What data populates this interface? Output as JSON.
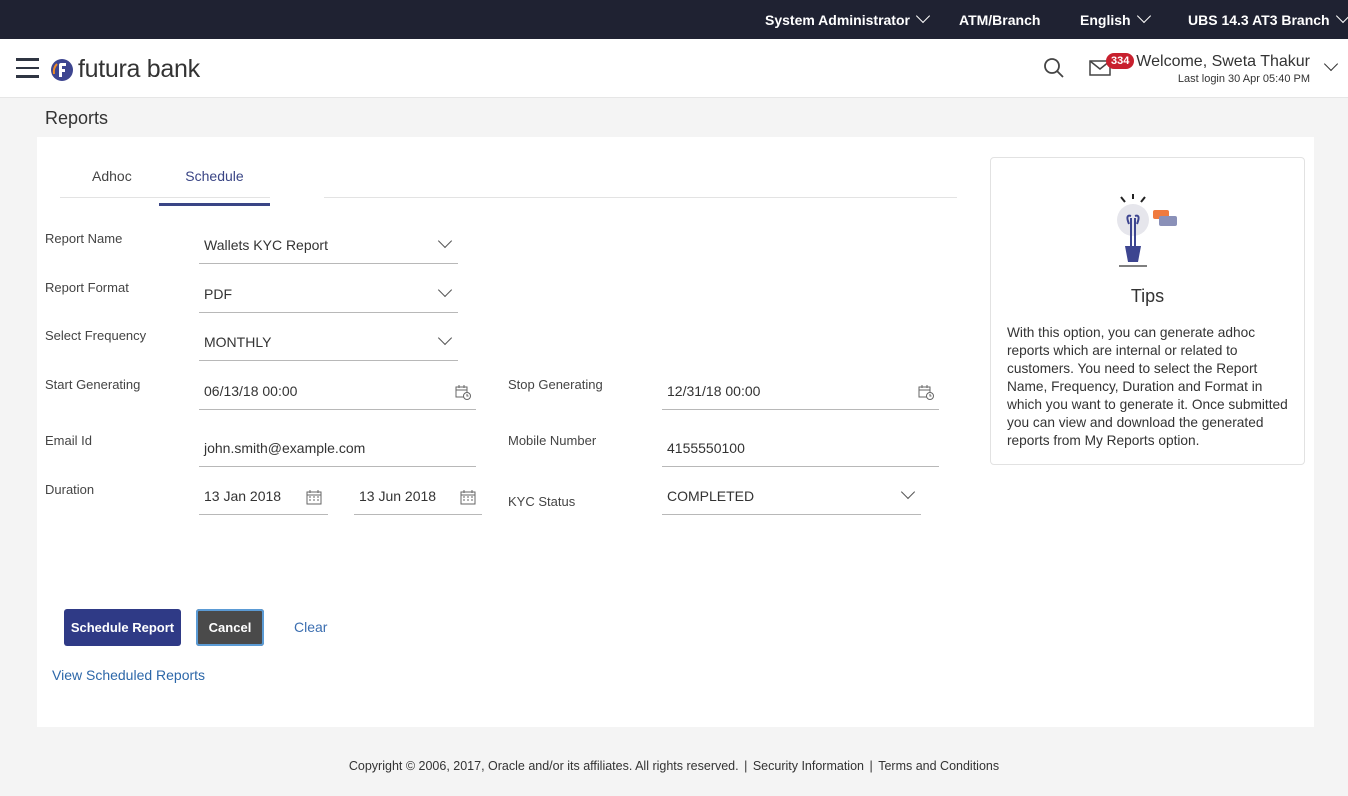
{
  "topbar": {
    "role": "System Administrator",
    "entity": "ATM/Branch",
    "language": "English",
    "branch": "UBS 14.3 AT3 Branch"
  },
  "header": {
    "logo_text": "futura bank",
    "notification_count": "334",
    "welcome": "Welcome, Sweta Thakur",
    "last_login": "Last login 30 Apr 05:40 PM"
  },
  "page": {
    "title": "Reports",
    "tabs": [
      {
        "label": "Adhoc"
      },
      {
        "label": "Schedule"
      }
    ]
  },
  "form": {
    "report_name": {
      "label": "Report Name",
      "value": "Wallets KYC Report"
    },
    "report_format": {
      "label": "Report Format",
      "value": "PDF"
    },
    "frequency": {
      "label": "Select Frequency",
      "value": "MONTHLY"
    },
    "start": {
      "label": "Start Generating",
      "value": "06/13/18 00:00"
    },
    "stop": {
      "label": "Stop Generating",
      "value": "12/31/18 00:00"
    },
    "email": {
      "label": "Email Id",
      "value": "john.smith@example.com"
    },
    "mobile": {
      "label": "Mobile Number",
      "value": "4155550100"
    },
    "duration": {
      "label": "Duration",
      "from": "13 Jan 2018",
      "to": "13 Jun 2018"
    },
    "kyc_status": {
      "label": "KYC Status",
      "value": "COMPLETED"
    }
  },
  "actions": {
    "schedule": "Schedule Report",
    "cancel": "Cancel",
    "clear": "Clear",
    "view_scheduled": "View Scheduled Reports"
  },
  "tips": {
    "title": "Tips",
    "body": "With this option, you can generate adhoc reports which are internal or related to customers. You need to select the Report Name, Frequency, Duration and Format in which you want to generate it. Once submitted you can view and download the generated reports from My Reports option."
  },
  "footer": {
    "copyright": "Copyright © 2006, 2017, Oracle and/or its affiliates. All rights reserved.",
    "security": "Security Information",
    "terms": "Terms and Conditions"
  },
  "colors": {
    "topbar": "#1f2232",
    "primary": "#2f3a86",
    "badge": "#c8202e",
    "link": "#2c67a9"
  }
}
